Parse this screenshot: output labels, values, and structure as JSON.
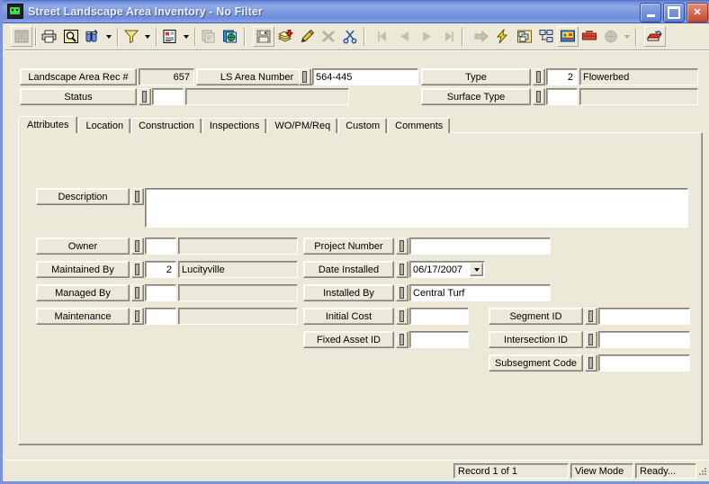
{
  "window": {
    "title": "Street Landscape Area Inventory - No Filter",
    "icon": "app-window-icon",
    "buttons": {
      "minimize": "minimize-button",
      "maximize": "maximize-button",
      "close": "close-button"
    }
  },
  "toolbar": {
    "items": [
      {
        "name": "new-record-icon",
        "label": "New",
        "enabled": false,
        "dropdown": false
      },
      {
        "name": "print-icon",
        "label": "Print",
        "enabled": true,
        "dropdown": false
      },
      {
        "name": "print-preview-icon",
        "label": "Print Preview",
        "enabled": true,
        "dropdown": false
      },
      {
        "name": "find-binoculars-icon",
        "label": "Find",
        "enabled": true,
        "dropdown": true
      },
      {
        "name": "filter-funnel-icon",
        "label": "Filter",
        "enabled": true,
        "dropdown": true
      },
      {
        "name": "report-icon",
        "label": "Reports",
        "enabled": true,
        "dropdown": true
      },
      {
        "name": "copy-record-icon",
        "label": "Copy Record",
        "enabled": false,
        "dropdown": false
      },
      {
        "name": "globe-documents-icon",
        "label": "Links",
        "enabled": true,
        "dropdown": false
      },
      {
        "name": "save-disk-icon",
        "label": "Save",
        "enabled": true,
        "dropdown": false
      },
      {
        "name": "add-layers-icon",
        "label": "Add",
        "enabled": true,
        "dropdown": false
      },
      {
        "name": "edit-pencil-icon",
        "label": "Edit",
        "enabled": true,
        "dropdown": false
      },
      {
        "name": "delete-x-icon",
        "label": "Delete",
        "enabled": false,
        "dropdown": false
      },
      {
        "name": "cut-scissors-icon",
        "label": "Cut",
        "enabled": true,
        "dropdown": false
      },
      {
        "name": "first-record-icon",
        "label": "First Record",
        "enabled": false,
        "dropdown": false
      },
      {
        "name": "previous-record-icon",
        "label": "Previous Record",
        "enabled": false,
        "dropdown": false
      },
      {
        "name": "next-record-icon",
        "label": "Next Record",
        "enabled": false,
        "dropdown": false
      },
      {
        "name": "last-record-icon",
        "label": "Last Record",
        "enabled": false,
        "dropdown": false
      },
      {
        "name": "goto-record-icon",
        "label": "Go To",
        "enabled": false,
        "dropdown": false
      },
      {
        "name": "lightning-action-icon",
        "label": "Quick Action",
        "enabled": true,
        "dropdown": false
      },
      {
        "name": "window-tile-icon",
        "label": "Windows",
        "enabled": true,
        "dropdown": false
      },
      {
        "name": "tree-view-icon",
        "label": "Tree View",
        "enabled": true,
        "dropdown": false
      },
      {
        "name": "map-view-icon",
        "label": "Map",
        "enabled": true,
        "dropdown": false
      },
      {
        "name": "toolbox-icon",
        "label": "Tools",
        "enabled": true,
        "dropdown": false
      },
      {
        "name": "globe-disabled-icon",
        "label": "Web",
        "enabled": false,
        "dropdown": true
      },
      {
        "name": "exit-door-icon",
        "label": "Exit",
        "enabled": true,
        "dropdown": false
      }
    ]
  },
  "header": {
    "rec_label": "Landscape Area Rec #",
    "rec_value": "657",
    "ls_area_label": "LS Area Number",
    "ls_area_value": "564-445",
    "status_label": "Status",
    "status_code": "",
    "status_desc": "",
    "type_label": "Type",
    "type_code": "2",
    "type_desc": "Flowerbed",
    "surface_label": "Surface Type",
    "surface_code": "",
    "surface_desc": ""
  },
  "tabs": [
    {
      "label": "Attributes",
      "active": true
    },
    {
      "label": "Location",
      "active": false
    },
    {
      "label": "Construction",
      "active": false
    },
    {
      "label": "Inspections",
      "active": false
    },
    {
      "label": "WO/PM/Req",
      "active": false
    },
    {
      "label": "Custom",
      "active": false
    },
    {
      "label": "Comments",
      "active": false
    }
  ],
  "attributes": {
    "description_label": "Description",
    "description_value": "",
    "left_fields": [
      {
        "label": "Owner",
        "code": "",
        "desc": ""
      },
      {
        "label": "Maintained By",
        "code": "2",
        "desc": "Lucityville"
      },
      {
        "label": "Managed By",
        "code": "",
        "desc": ""
      },
      {
        "label": "Maintenance",
        "code": "",
        "desc": ""
      }
    ],
    "mid_fields": [
      {
        "label": "Project Number",
        "value": ""
      },
      {
        "label": "Date Installed",
        "value": "06/17/2007"
      },
      {
        "label": "Installed By",
        "value": "Central Turf"
      },
      {
        "label": "Initial Cost",
        "value": ""
      },
      {
        "label": "Fixed Asset ID",
        "value": ""
      }
    ],
    "right_fields": [
      {
        "label": "Segment ID",
        "value": ""
      },
      {
        "label": "Intersection ID",
        "value": ""
      },
      {
        "label": "Subsegment Code",
        "value": ""
      }
    ]
  },
  "statusbar": {
    "record": "Record 1 of 1",
    "mode": "View Mode",
    "state": "Ready..."
  },
  "colors": {
    "title_gradient_start": "#4b6bc8",
    "title_gradient_end": "#8fa8e6",
    "window_border": "#7b93dd",
    "face": "#ece9d8",
    "shadow": "#808080",
    "field_white": "#ffffff"
  }
}
